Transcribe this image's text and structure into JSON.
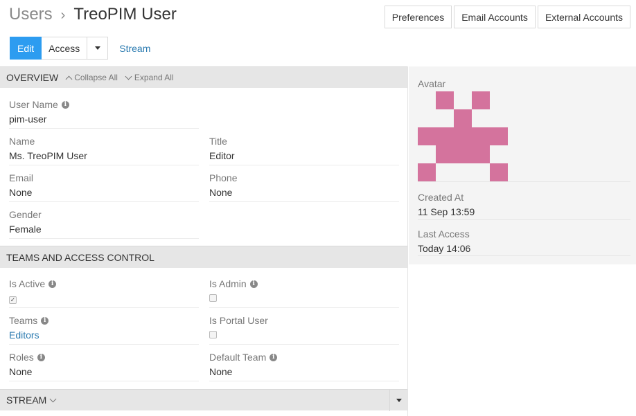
{
  "breadcrumb": {
    "parent": "Users",
    "separator": "›",
    "current": "TreoPIM User"
  },
  "top_buttons": {
    "preferences": "Preferences",
    "email_accounts": "Email Accounts",
    "external_accounts": "External Accounts"
  },
  "actions": {
    "edit": "Edit",
    "access": "Access",
    "stream": "Stream"
  },
  "overview": {
    "title": "OVERVIEW",
    "collapse_all": "Collapse All",
    "expand_all": "Expand All",
    "user_name_label": "User Name",
    "user_name": "pim-user",
    "name_label": "Name",
    "name": "Ms. TreoPIM User",
    "title_label": "Title",
    "title_value": "Editor",
    "email_label": "Email",
    "email": "None",
    "phone_label": "Phone",
    "phone": "None",
    "gender_label": "Gender",
    "gender": "Female"
  },
  "teams": {
    "title": "TEAMS AND ACCESS CONTROL",
    "is_active_label": "Is Active",
    "is_active": true,
    "is_admin_label": "Is Admin",
    "is_admin": false,
    "teams_label": "Teams",
    "teams_value": "Editors",
    "is_portal_label": "Is Portal User",
    "is_portal": false,
    "roles_label": "Roles",
    "roles_value": "None",
    "default_team_label": "Default Team",
    "default_team_value": "None"
  },
  "stream": {
    "title": "STREAM"
  },
  "side": {
    "avatar_label": "Avatar",
    "avatar_color": "#d4739d",
    "created_label": "Created At",
    "created_value": "11 Sep 13:59",
    "access_label": "Last Access",
    "access_value": "Today 14:06"
  },
  "colors": {
    "accent": "#2d9cf0",
    "link": "#2a7ab0"
  }
}
